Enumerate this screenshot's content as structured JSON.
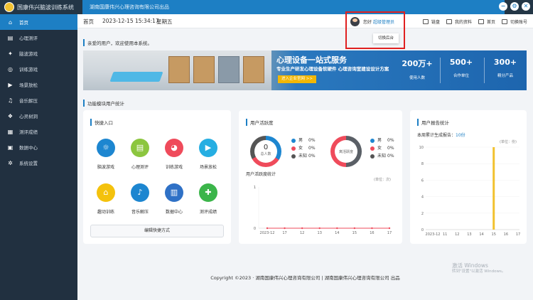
{
  "titlebar": {
    "app_name": "国康伟兴脑波训练系统",
    "company": "湖南国康伟兴心理咨询有限公司出品",
    "buttons": [
      "−",
      "⚙",
      "✕"
    ]
  },
  "sidebar": {
    "items": [
      {
        "label": "首页",
        "icon": "home-icon",
        "glyph": "⌂"
      },
      {
        "label": "心理测评",
        "icon": "clipboard-icon",
        "glyph": "▤"
      },
      {
        "label": "脑波游戏",
        "icon": "gamepad-icon",
        "glyph": "✦"
      },
      {
        "label": "训练游戏",
        "icon": "target-icon",
        "glyph": "◎"
      },
      {
        "label": "场景放松",
        "icon": "video-icon",
        "glyph": "▶"
      },
      {
        "label": "音乐解压",
        "icon": "music-icon",
        "glyph": "♫"
      },
      {
        "label": "心灵树洞",
        "icon": "tree-icon",
        "glyph": "❖"
      },
      {
        "label": "测评成绩",
        "icon": "grade-icon",
        "glyph": "▦"
      },
      {
        "label": "数据中心",
        "icon": "data-icon",
        "glyph": "▣"
      },
      {
        "label": "系统设置",
        "icon": "settings-icon",
        "glyph": "✲"
      }
    ]
  },
  "header": {
    "home": "首页",
    "datetime": "2023-12-15 15:34:17",
    "weekday": "星期五",
    "greeting": "您好",
    "role": "超级管理员",
    "switch_popup": "切换后台",
    "links": [
      {
        "label": "链盘",
        "icon": "keyboard-icon"
      },
      {
        "label": "我的资料",
        "icon": "profile-icon"
      },
      {
        "label": "首页",
        "icon": "home-icon"
      },
      {
        "label": "切换账号",
        "icon": "switch-account-icon"
      }
    ]
  },
  "main": {
    "welcome": "亲爱的用户，欢迎使用本系统。",
    "banner": {
      "headline": "心理设备一站式服务",
      "subline": "专业生产研发心理设备软硬件 心理咨询室建设设计方案",
      "cta": "进入企业官网 >>",
      "stats": [
        {
          "value": "200万+",
          "label": "使用人数"
        },
        {
          "value": "500+",
          "label": "合作单位"
        },
        {
          "value": "300+",
          "label": "精分产品"
        }
      ]
    },
    "section_title": "功能模块用户统计"
  },
  "quick_entry": {
    "title": "快捷入口",
    "items": [
      {
        "label": "脑波游戏",
        "icon": "bulb-icon",
        "color": "#1d86d0",
        "glyph": "☼"
      },
      {
        "label": "心理测评",
        "icon": "form-icon",
        "color": "#8cc63f",
        "glyph": "▤"
      },
      {
        "label": "训练游戏",
        "icon": "game-icon",
        "color": "#ef4b5b",
        "glyph": "◕"
      },
      {
        "label": "场景放松",
        "icon": "camera-icon",
        "color": "#26aee2",
        "glyph": "▶"
      },
      {
        "label": "趣动训练",
        "icon": "house-icon",
        "color": "#f4c20d",
        "glyph": "⌂"
      },
      {
        "label": "音乐解压",
        "icon": "music-note-icon",
        "color": "#1d86d0",
        "glyph": "♪"
      },
      {
        "label": "数据中心",
        "icon": "bar-chart-icon",
        "color": "#2f71c6",
        "glyph": "▥"
      },
      {
        "label": "测评成绩",
        "icon": "report-icon",
        "color": "#3bb54a",
        "glyph": "✚"
      }
    ],
    "edit_label": "编辑快捷方式"
  },
  "activity": {
    "title": "用户活跃度",
    "donut1": {
      "value": "0",
      "label": "总人数"
    },
    "donut2": {
      "label": "离活跃度"
    },
    "legend": [
      {
        "key": "男",
        "value": "0%",
        "color": "#1d86d0"
      },
      {
        "key": "女",
        "value": "0%",
        "color": "#ef4b5b"
      },
      {
        "key": "未知",
        "value": "0%",
        "color": "#555555"
      }
    ],
    "chart_title": "用户活跃度统计",
    "unit": "(单位：次)"
  },
  "report": {
    "title": "用户报告统计",
    "summary_label": "本周累计生成报告：",
    "summary_value": "10份",
    "unit": "(单位：份)"
  },
  "chart_data": [
    {
      "type": "line",
      "title": "用户活跃度统计",
      "x": [
        "2023-12",
        "17",
        "12",
        "13",
        "14",
        "15",
        "16",
        "17"
      ],
      "series": [
        {
          "values": [
            0,
            0,
            0,
            0,
            0,
            0,
            0,
            0
          ]
        }
      ],
      "yticks": [
        "1",
        "0"
      ],
      "ylim": [
        0,
        1
      ],
      "color": "#ef4b5b"
    },
    {
      "type": "bar",
      "title": "用户报告统计",
      "categories": [
        "2023-12",
        "11",
        "12",
        "13",
        "14",
        "15",
        "16",
        "17"
      ],
      "values": [
        0,
        0,
        0,
        0,
        0,
        10,
        0,
        0
      ],
      "yticks": [
        "10",
        "8",
        "6",
        "4",
        "2",
        "0"
      ],
      "ylim": [
        0,
        10
      ],
      "color": "#f2c12e"
    }
  ],
  "footer": "Copyright ©2023 · 湖南国康伟兴心理咨询有限公司  |  湖南国康伟兴心理咨询有限公司 出品",
  "activation": {
    "line1": "激活 Windows",
    "line2": "转到\"设置\"以激活 Windows。"
  }
}
